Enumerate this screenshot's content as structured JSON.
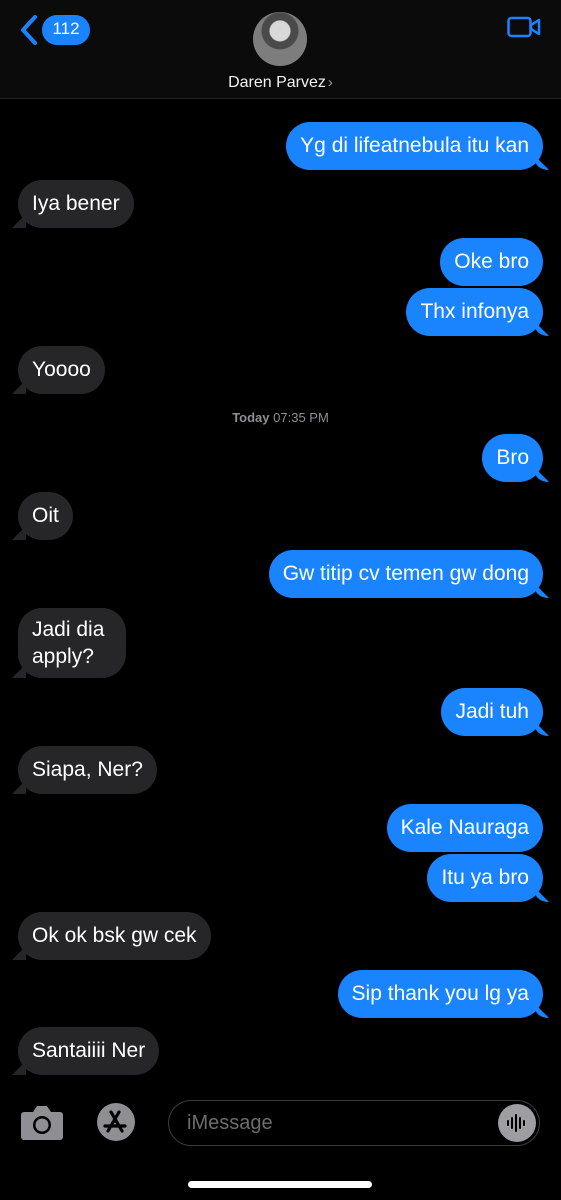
{
  "header": {
    "back_count": "112",
    "contact_name": "Daren Parvez",
    "chevron": "›",
    "icons": {
      "back": "chevron-left-icon",
      "video": "video-camera-icon"
    },
    "accent": "#1a84ff"
  },
  "timestamp": {
    "day": "Today",
    "time": "07:35 PM"
  },
  "messages": [
    {
      "dir": "sent",
      "text": "Yg di lifeatnebula itu kan"
    },
    {
      "dir": "recv",
      "text": "Iya bener"
    },
    {
      "dir": "sent",
      "text": "Oke bro"
    },
    {
      "dir": "sent",
      "text": "Thx infonya"
    },
    {
      "dir": "recv",
      "text": "Yoooo"
    },
    {
      "dir": "sent",
      "text": "Bro"
    },
    {
      "dir": "recv",
      "text": "Oit"
    },
    {
      "dir": "sent",
      "text": "Gw titip cv temen gw dong"
    },
    {
      "dir": "recv",
      "text": "Jadi dia apply?"
    },
    {
      "dir": "sent",
      "text": "Jadi tuh"
    },
    {
      "dir": "recv",
      "text": "Siapa, Ner?"
    },
    {
      "dir": "sent",
      "text": "Kale Nauraga"
    },
    {
      "dir": "sent",
      "text": "Itu ya bro"
    },
    {
      "dir": "recv",
      "text": "Ok ok bsk gw cek"
    },
    {
      "dir": "sent",
      "text": "Sip thank you lg ya"
    },
    {
      "dir": "recv",
      "text": "Santaiiii Ner"
    }
  ],
  "composer": {
    "placeholder": "iMessage",
    "icons": {
      "camera": "camera-icon",
      "apps": "app-store-icon",
      "audio": "audio-waveform-icon"
    }
  },
  "colors": {
    "sent": "#1a84ff",
    "received": "#262628",
    "background": "#000000"
  }
}
